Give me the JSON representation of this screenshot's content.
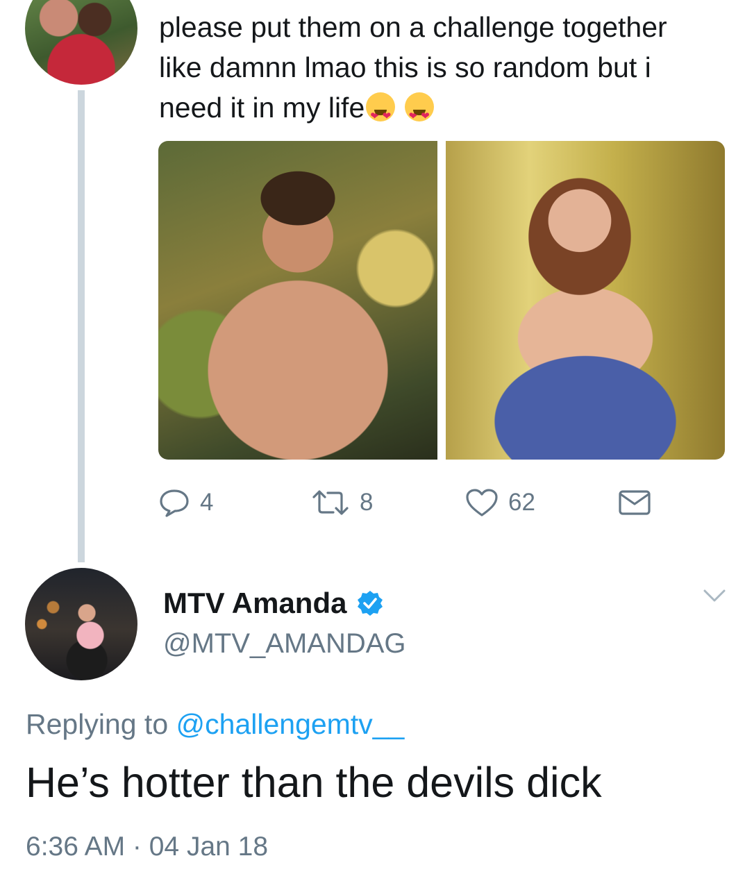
{
  "previous_tweet": {
    "text_lines": [
      "please put them on a challenge together",
      "like damnn lmao this is so random but i",
      "need it in my life"
    ],
    "emoji_count": 2,
    "emoji_icon": "heart-eyes-emoji-icon",
    "images": [
      "shirtless-man-photo",
      "woman-in-blue-dress-photo"
    ],
    "actions": {
      "reply_count": "4",
      "retweet_count": "8",
      "like_count": "62"
    }
  },
  "reply_tweet": {
    "display_name": "MTV Amanda",
    "verified": true,
    "handle": "@MTV_AMANDAG",
    "replying_prefix": "Replying to",
    "replying_to": "@challengemtv__",
    "text": "He’s hotter than the devils dick",
    "timestamp": "6:36 AM · 04 Jan 18"
  },
  "colors": {
    "link": "#1da1f2",
    "secondary_text": "#657786",
    "thread_line": "#ccd6dd",
    "verified_badge": "#1da1f2"
  }
}
